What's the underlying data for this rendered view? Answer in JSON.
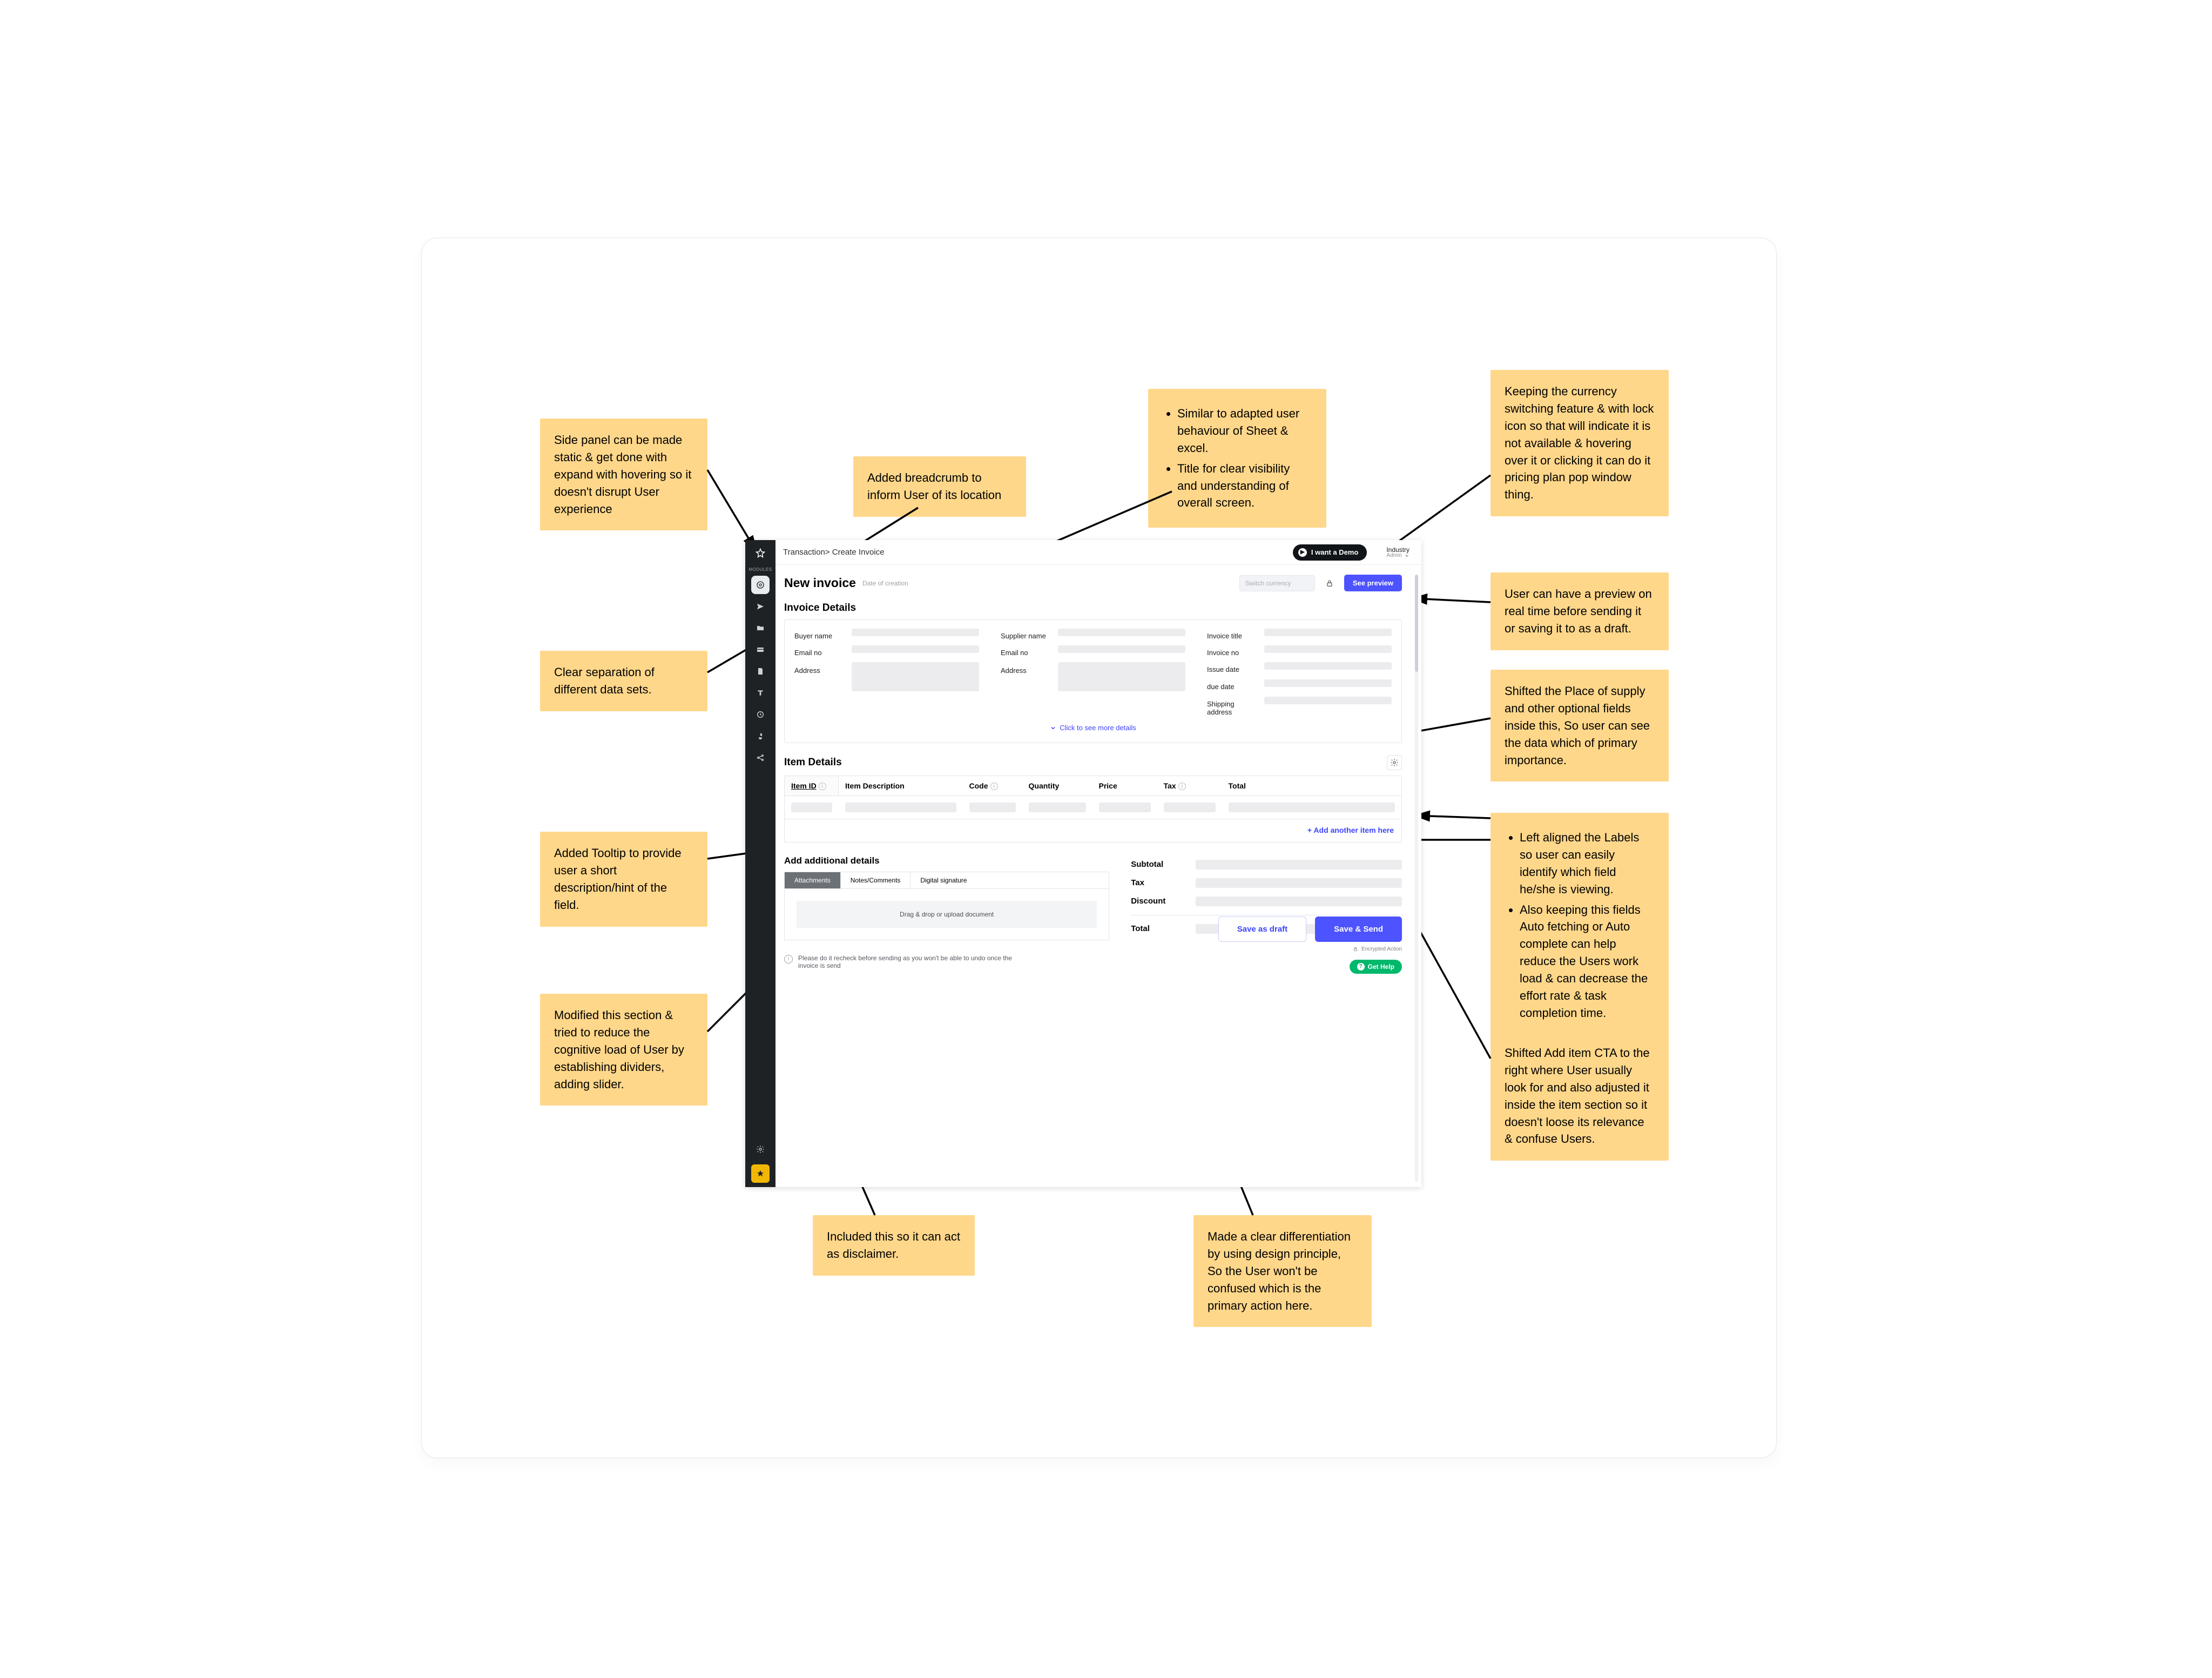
{
  "notes": {
    "n1": "Side panel can be made static & get done with expand with hovering so it doesn't disrupt User experience",
    "n2": "Added breadcrumb to inform User of its location",
    "n3a": "Similar to adapted user behaviour of Sheet & excel.",
    "n3b": "Title for clear visibility and understanding of overall screen.",
    "n4": "Keeping the currency switching feature & with lock icon so that will indicate it is not available & hovering over it or clicking it can do it pricing plan pop window thing.",
    "n5": "User can have a preview on real time before sending it or saving it to as a draft.",
    "n6": "Clear separation of different data sets.",
    "n7": "Shifted the Place of supply and other optional fields inside this, So user can see the data which of primary importance.",
    "n8": "Added Tooltip to provide user a short description/hint of the field.",
    "n9a": "Left aligned the Labels so user can easily identify which field he/she is viewing.",
    "n9b": "Also keeping this fields Auto fetching or Auto complete can help reduce the Users work load & can decrease the effort rate & task completion time.",
    "n10": "Shifted Add item CTA to the right where User usually look for and also adjusted it inside the item section so it doesn't loose its relevance & confuse Users.",
    "n11": "Modified this section & tried to reduce the cognitive load of User by establishing dividers, adding slider.",
    "n12": "Included this so it can act as disclaimer.",
    "n13": "Made a clear differentiation by using design principle, So the User won't be confused which is the primary action here."
  },
  "sidebar": {
    "modules_label": "MODULES"
  },
  "topbar": {
    "breadcrumb": "Transaction> Create Invoice",
    "demo_label": "I want a Demo",
    "industry_label": "Industry",
    "industry_value": "Admin"
  },
  "title": {
    "heading": "New invoice",
    "sub": "Date of creation",
    "currency_placeholder": "Switch currency",
    "preview": "See preview"
  },
  "invoice_details": {
    "heading": "Invoice Details",
    "buyer_name": "Buyer name",
    "email1": "Email no",
    "address1": "Address",
    "supplier_name": "Supplier name",
    "email2": "Email no",
    "address2": "Address",
    "invoice_title": "Invoice title",
    "invoice_no": "Invoice no",
    "issue_date": "Issue date",
    "due_date": "due date",
    "shipping_address": "Shipping address",
    "expand": "Click to see more details"
  },
  "items": {
    "heading": "Item Details",
    "cols": {
      "id": "Item ID",
      "desc": "Item Description",
      "code": "Code",
      "qty": "Quantity",
      "price": "Price",
      "tax": "Tax",
      "total": "Total"
    },
    "add_link": "+ Add another item here"
  },
  "additional": {
    "heading": "Add additional details",
    "tab1": "Attachments",
    "tab2": "Notes/Comments",
    "tab3": "Digital signature",
    "dropzone": "Drag & drop or upload document"
  },
  "totals": {
    "subtotal": "Subtotal",
    "tax": "Tax",
    "discount": "Discount",
    "total": "Total"
  },
  "disclaimer": "Please do it recheck before sending as you won't be able to undo once the invoice is send",
  "actions": {
    "draft": "Save as draft",
    "send": "Save & Send",
    "encrypted": "Encrypted Action",
    "help": "Get Help"
  }
}
